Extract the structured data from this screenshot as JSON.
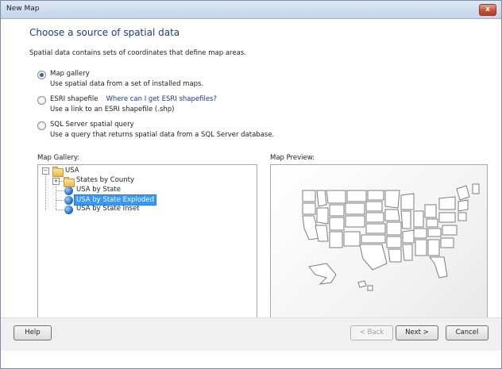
{
  "window": {
    "title": "New Map",
    "close_symbol": "x"
  },
  "heading": "Choose a source of spatial data",
  "description": "Spatial data contains sets of coordinates that define map areas.",
  "options": [
    {
      "label": "Map gallery",
      "sub": "Use spatial data from a set of installed maps.",
      "checked": true
    },
    {
      "label": "ESRI shapefile",
      "link": "Where can I get ESRI shapefiles?",
      "sub": "Use a link to an ESRI shapefile (.shp)",
      "checked": false
    },
    {
      "label": "SQL Server spatial query",
      "sub": "Use a query that returns spatial data from a SQL Server database.",
      "checked": false
    }
  ],
  "gallery": {
    "label": "Map Gallery:",
    "root": {
      "label": "USA",
      "expander": "−"
    },
    "items": [
      {
        "label": "States by County",
        "icon": "folder-icon",
        "expander": "+"
      },
      {
        "label": "USA by State",
        "icon": "globe-icon"
      },
      {
        "label": "USA by State Exploded",
        "icon": "globe-icon",
        "selected": true
      },
      {
        "label": "USA by State Inset",
        "icon": "globe-icon"
      }
    ]
  },
  "preview": {
    "label": "Map Preview:"
  },
  "buttons": {
    "help": "Help",
    "back": "< Back",
    "next": "Next >",
    "cancel": "Cancel"
  }
}
